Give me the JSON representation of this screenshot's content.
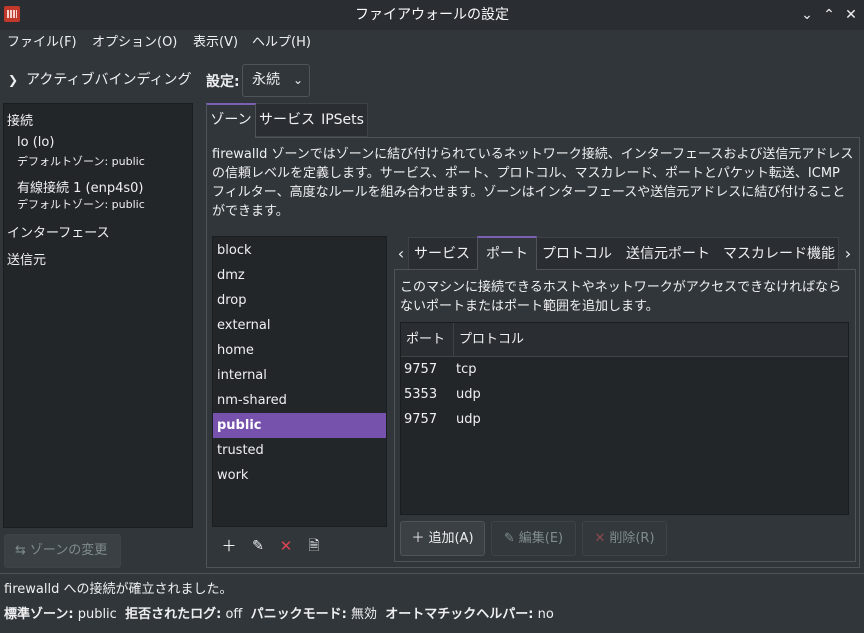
{
  "window": {
    "title": "ファイアウォールの設定"
  },
  "menu": [
    "ファイル(F)",
    "オプション(O)",
    "表示(V)",
    "ヘルプ(H)"
  ],
  "left": {
    "active_bindings": "アクティブバインディング",
    "connections_header": "接続",
    "connections": [
      {
        "name": "lo (lo)",
        "zone": "デフォルトゾーン: public"
      },
      {
        "name": "有線接続 1 (enp4s0)",
        "zone": "デフォルトゾーン: public"
      }
    ],
    "interfaces_header": "インターフェース",
    "sources_header": "送信元",
    "change_zone": "ゾーンの変更"
  },
  "settings": {
    "label": "設定:",
    "value": "永続"
  },
  "tabs": [
    "ゾーン",
    "サービス",
    "IPSets"
  ],
  "zone_description": "firewalld ゾーンではゾーンに結び付けられているネットワーク接続、インターフェースおよび送信元アドレスの信頼レベルを定義します。サービス、ポート、プロトコル、マスカレード、ポートとパケット転送、ICMP フィルター、高度なルールを組み合わせます。ゾーンはインターフェースや送信元アドレスに結び付けることができます。",
  "zones": [
    "block",
    "dmz",
    "drop",
    "external",
    "home",
    "internal",
    "nm-shared",
    "public",
    "trusted",
    "work"
  ],
  "selected_zone": "public",
  "subtabs": [
    "サービス",
    "ポート",
    "プロトコル",
    "送信元ポート",
    "マスカレード機能"
  ],
  "ports": {
    "description": "このマシンに接続できるホストやネットワークがアクセスできなければならないポートまたはポート範囲を追加します。",
    "col_port": "ポート",
    "col_protocol": "プロトコル",
    "rows": [
      {
        "port": "9757",
        "protocol": "tcp"
      },
      {
        "port": "5353",
        "protocol": "udp"
      },
      {
        "port": "9757",
        "protocol": "udp"
      }
    ],
    "add": "追加(A)",
    "edit": "編集(E)",
    "remove": "削除(R)"
  },
  "status": {
    "message": "firewalld への接続が確立されました。",
    "default_zone_label": "標準ゾーン:",
    "default_zone": "public",
    "log_denied_label": "拒否されたログ:",
    "log_denied": "off",
    "panic_label": "パニックモード:",
    "panic": "無効",
    "helpers_label": "オートマチックヘルパー:",
    "helpers": "no"
  },
  "colors": {
    "accent": "#7652ad",
    "background": "#31363b",
    "list_bg": "#232629"
  }
}
